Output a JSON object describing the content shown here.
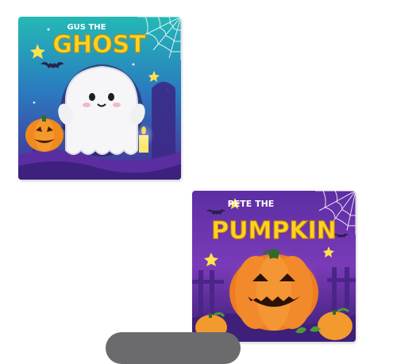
{
  "products": [
    {
      "title_small": "GUS THE",
      "title_big": "GHOST",
      "colors": {
        "top": "#2bb5b8",
        "mid": "#2a6fb7",
        "bottom": "#4a2a93"
      }
    },
    {
      "title_small": "PETE THE",
      "title_big": "PUMPKIN",
      "colors": {
        "top": "#5a2d9c",
        "mid": "#7b3ab5",
        "bottom": "#3a1d6e"
      }
    }
  ]
}
